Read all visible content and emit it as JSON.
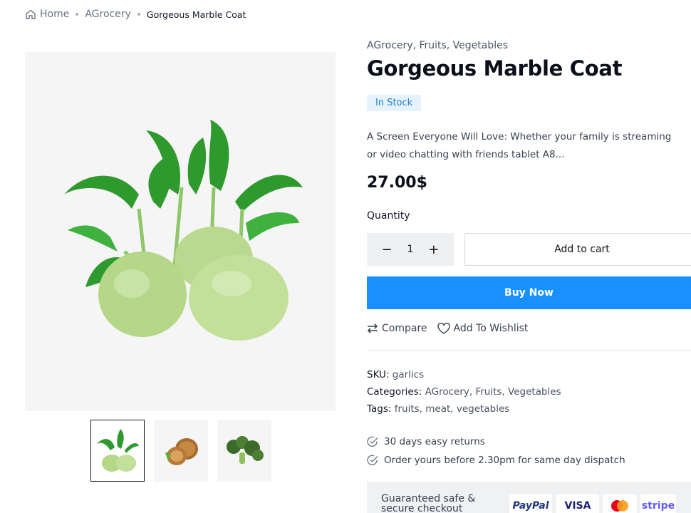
{
  "breadcrumb": {
    "home": "Home",
    "category": "AGrocery",
    "current": "Gorgeous Marble Coat"
  },
  "product": {
    "categories_line": "AGrocery, Fruits, Vegetables",
    "title": "Gorgeous Marble Coat",
    "stock": "In Stock",
    "description": "A Screen Everyone Will Love: Whether your family is streaming or video chatting with friends tablet A8...",
    "price": "27.00$"
  },
  "purchase": {
    "quantity_label": "Quantity",
    "quantity_value": "1",
    "minus": "−",
    "plus": "+",
    "add_to_cart": "Add to cart",
    "buy_now": "Buy Now"
  },
  "actions": {
    "compare": "Compare",
    "wishlist": "Add To Wishlist"
  },
  "meta": {
    "sku_label": "SKU:",
    "sku": "garlics",
    "categories_label": "Categories:",
    "categories": [
      "AGrocery",
      "Fruits",
      "Vegetables"
    ],
    "tags_label": "Tags:",
    "tags": [
      "fruits",
      "meat",
      "vegetables"
    ]
  },
  "perks": [
    "30 days easy returns",
    "Order yours before 2.30pm for same day dispatch"
  ],
  "checkout": {
    "label": "Guaranteed safe & secure checkout",
    "payments": [
      "PayPal",
      "VISA",
      "mastercard",
      "stripe"
    ]
  },
  "thumbnails": [
    "kohlrabi",
    "walnuts",
    "broccoli"
  ],
  "colors": {
    "accent": "#1890ff",
    "stock_bg": "#e6f3fd",
    "stock_text": "#1e7fd0"
  }
}
